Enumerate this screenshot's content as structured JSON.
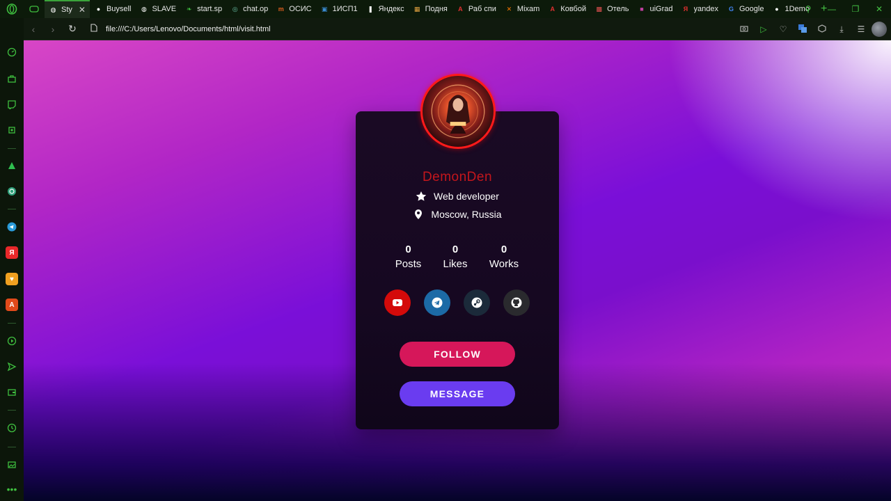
{
  "browser": {
    "tabs": [
      {
        "label": "Sty",
        "favicon": "globe-icon",
        "color": "#ffffff",
        "active": true
      },
      {
        "label": "Buysell",
        "favicon": "github-icon",
        "color": "#ffffff"
      },
      {
        "label": "SLAVE",
        "favicon": "globe-icon",
        "color": "#ffffff"
      },
      {
        "label": "start.sp",
        "favicon": "leaf-icon",
        "color": "#3fbf3f"
      },
      {
        "label": "chat.op",
        "favicon": "openai-icon",
        "color": "#6ac0a6"
      },
      {
        "label": "ОСИС",
        "favicon": "m-icon",
        "color": "#e06020"
      },
      {
        "label": "1ИСП1",
        "favicon": "person-icon",
        "color": "#3a8ad0"
      },
      {
        "label": "Яндекс",
        "favicon": "pause-icon",
        "color": "#ffffff"
      },
      {
        "label": "Подня",
        "favicon": "photo-icon",
        "color": "#e0a040"
      },
      {
        "label": "Раб спи",
        "favicon": "a-icon",
        "color": "#e03030"
      },
      {
        "label": "Mixam",
        "favicon": "figure-icon",
        "color": "#ff7a00"
      },
      {
        "label": "Ковбой",
        "favicon": "a-icon",
        "color": "#e03030"
      },
      {
        "label": "Отель",
        "favicon": "tile-icon",
        "color": "#e05050"
      },
      {
        "label": "uiGrad",
        "favicon": "gradient-icon",
        "color": "#c040a0"
      },
      {
        "label": "yandex",
        "favicon": "ya-icon",
        "color": "#e03030"
      },
      {
        "label": "Google",
        "favicon": "google-icon",
        "color": "#4285f4"
      },
      {
        "label": "1Demo",
        "favicon": "github-icon",
        "color": "#ffffff"
      }
    ],
    "url": "file:///C:/Users/Lenovo/Documents/html/visit.html"
  },
  "profile": {
    "name": "DemonDen",
    "role": "Web developer",
    "location": "Moscow, Russia",
    "stats": [
      {
        "value": "0",
        "label": "Posts"
      },
      {
        "value": "0",
        "label": "Likes"
      },
      {
        "value": "0",
        "label": "Works"
      }
    ],
    "social": [
      {
        "name": "youtube",
        "icon": "youtube-icon",
        "color": "#d40a0a"
      },
      {
        "name": "telegram",
        "icon": "telegram-icon",
        "color": "#1c6aa6"
      },
      {
        "name": "steam",
        "icon": "steam-icon",
        "color": "#1b2a3a"
      },
      {
        "name": "github",
        "icon": "github-icon",
        "color": "#2a2a2e"
      }
    ],
    "follow_label": "FOLLOW",
    "message_label": "MESSAGE",
    "name_color": "#c4161c",
    "follow_color": "#d6175a",
    "message_color": "#6a3cf0"
  }
}
